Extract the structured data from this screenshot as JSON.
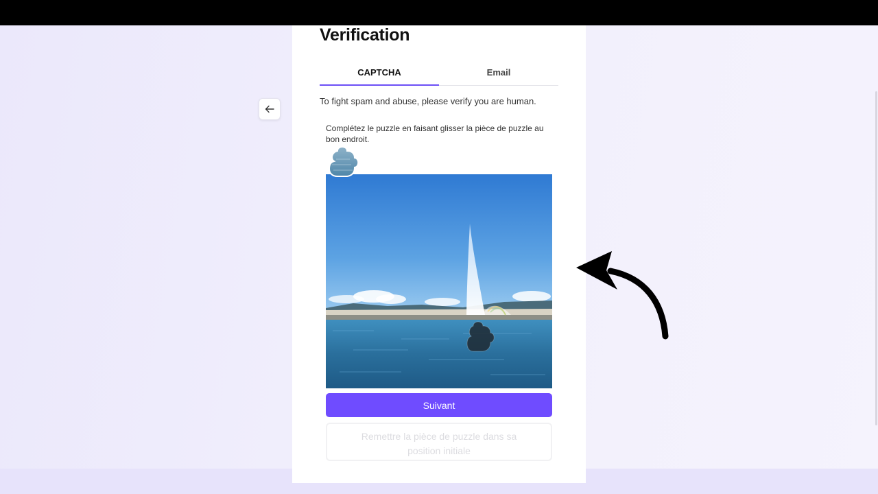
{
  "header": {
    "title": "Verification"
  },
  "tabs": [
    {
      "label": "CAPTCHA",
      "active": true
    },
    {
      "label": "Email",
      "active": false
    }
  ],
  "intro_text": "To fight spam and abuse, please verify you are human.",
  "captcha": {
    "instruction": "Complétez le puzzle en faisant glisser la pièce de puzzle au bon endroit.",
    "next_label": "Suivant",
    "reset_label": "Remettre la pièce de puzzle dans sa position initiale"
  },
  "icons": {
    "back": "arrow-left-icon",
    "annotation": "curved-arrow-icon"
  },
  "colors": {
    "accent": "#6f4cff",
    "tab_underline": "#6b4ef6",
    "sky": "#3f86d6",
    "water": "#2a6f9c"
  }
}
